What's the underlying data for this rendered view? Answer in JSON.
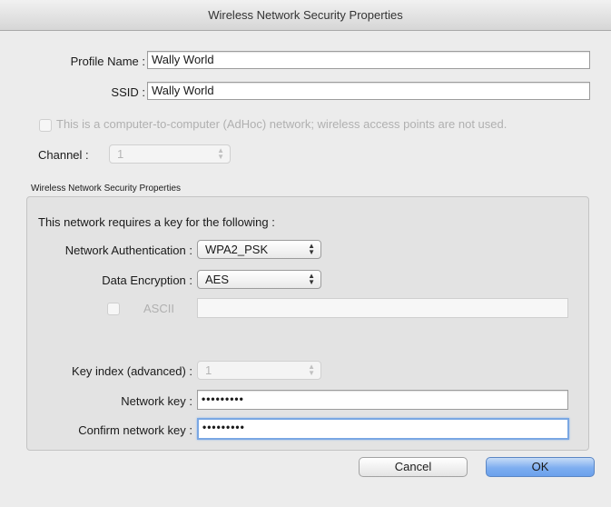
{
  "window": {
    "title": "Wireless Network Security Properties"
  },
  "profile": {
    "label": "Profile Name :",
    "value": "Wally World"
  },
  "ssid": {
    "label": "SSID :",
    "value": "Wally World"
  },
  "adhoc": {
    "label": "This is a computer-to-computer (AdHoc) network; wireless access points are not used.",
    "checked": false
  },
  "channel": {
    "label": "Channel :",
    "value": "1"
  },
  "security_group": {
    "title": "Wireless Network Security Properties",
    "intro": "This network requires a key for the following :",
    "auth_label": "Network Authentication :",
    "auth_value": "WPA2_PSK",
    "enc_label": "Data Encryption :",
    "enc_value": "AES",
    "ascii_label": "ASCII",
    "ascii_value": "",
    "key_index_label": "Key index (advanced) :",
    "key_index_value": "1",
    "network_key_label": "Network key :",
    "network_key_value": "•••••••••",
    "confirm_key_label": "Confirm network key :",
    "confirm_key_value": "•••••••••"
  },
  "buttons": {
    "cancel": "Cancel",
    "ok": "OK"
  },
  "colors": {
    "ok_button": "#7eaef0",
    "focus_ring": "#7aa7e3"
  }
}
